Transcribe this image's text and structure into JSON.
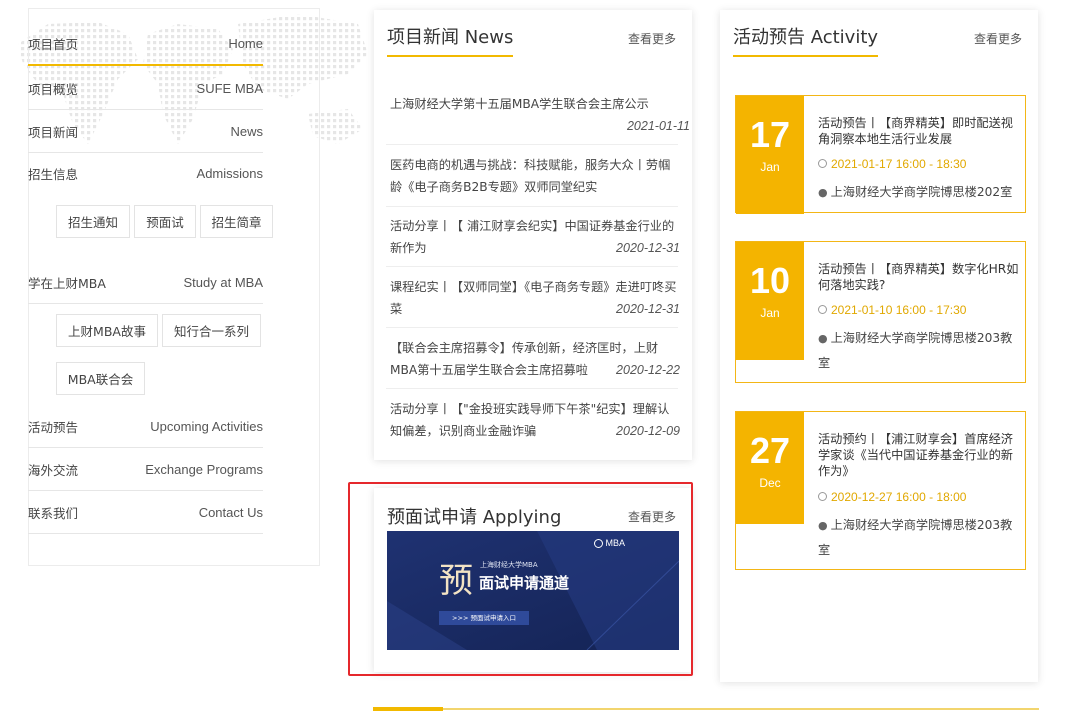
{
  "nav": {
    "items": [
      {
        "zh": "项目首页",
        "en": "Home"
      },
      {
        "zh": "项目概览",
        "en": "SUFE MBA"
      },
      {
        "zh": "项目新闻",
        "en": "News"
      },
      {
        "zh": "招生信息",
        "en": "Admissions"
      },
      {
        "zh": "学在上财MBA",
        "en": "Study at MBA"
      },
      {
        "zh": "活动预告",
        "en": "Upcoming Activities"
      },
      {
        "zh": "海外交流",
        "en": "Exchange Programs"
      },
      {
        "zh": "联系我们",
        "en": "Contact Us"
      }
    ],
    "admission_chips": [
      "招生通知",
      "预面试",
      "招生简章"
    ],
    "study_chips": [
      "上财MBA故事",
      "知行合一系列",
      "MBA联合会"
    ]
  },
  "news": {
    "title": "项目新闻 News",
    "more": "查看更多",
    "items": [
      {
        "text": "上海财经大学第十五届MBA学生联合会主席公示",
        "date": "2021-01-11"
      },
      {
        "text": "医药电商的机遇与挑战：科技赋能，服务大众丨劳帼龄《电子商务B2B专题》双师同堂纪实",
        "date": ""
      },
      {
        "text": "活动分享丨【 浦江财享会纪实】中国证券基金行业的新作为",
        "date": "2020-12-31"
      },
      {
        "text": "课程纪实丨【双师同堂】《电子商务专题》走进叮咚买菜",
        "date": "2020-12-31"
      },
      {
        "text": "【联合会主席招募令】传承创新，经济匡时，上财MBA第十五届学生联合会主席招募啦",
        "date": "2020-12-22"
      },
      {
        "text": "活动分享丨【\"金投班实践导师下午茶\"纪实】理解认知偏差，识别商业金融诈骗",
        "date": "2020-12-09"
      }
    ]
  },
  "applying": {
    "title": "预面试申请 Applying",
    "more": "查看更多",
    "banner": {
      "logo_text": "MBA",
      "big_char": "预",
      "subtitle": "上海财经大学MBA",
      "headline": "面试申请通道",
      "button": ">>> 预面试申请入口"
    }
  },
  "activity": {
    "title": "活动预告 Activity",
    "more": "查看更多",
    "items": [
      {
        "day": "17",
        "month": "Jan",
        "title": "活动预告丨【商界精英】即时配送视角洞察本地生活行业发展",
        "time": "2021-01-17 16:00 - 18:30",
        "location": "上海财经大学商学院博思楼202室"
      },
      {
        "day": "10",
        "month": "Jan",
        "title": "活动预告丨【商界精英】数字化HR如何落地实践?",
        "time": "2021-01-10 16:00 - 17:30",
        "location": "上海财经大学商学院博思楼203教室"
      },
      {
        "day": "27",
        "month": "Dec",
        "title": "活动预约丨【浦江财享会】首席经济学家谈《当代中国证券基金行业的新作为》",
        "time": "2020-12-27 16:00 - 18:00",
        "location": "上海财经大学商学院博思楼203教室"
      }
    ]
  },
  "colors": {
    "accent": "#f4b400",
    "highlight_border": "#e5282c",
    "banner_bg": "#1d2d66"
  }
}
